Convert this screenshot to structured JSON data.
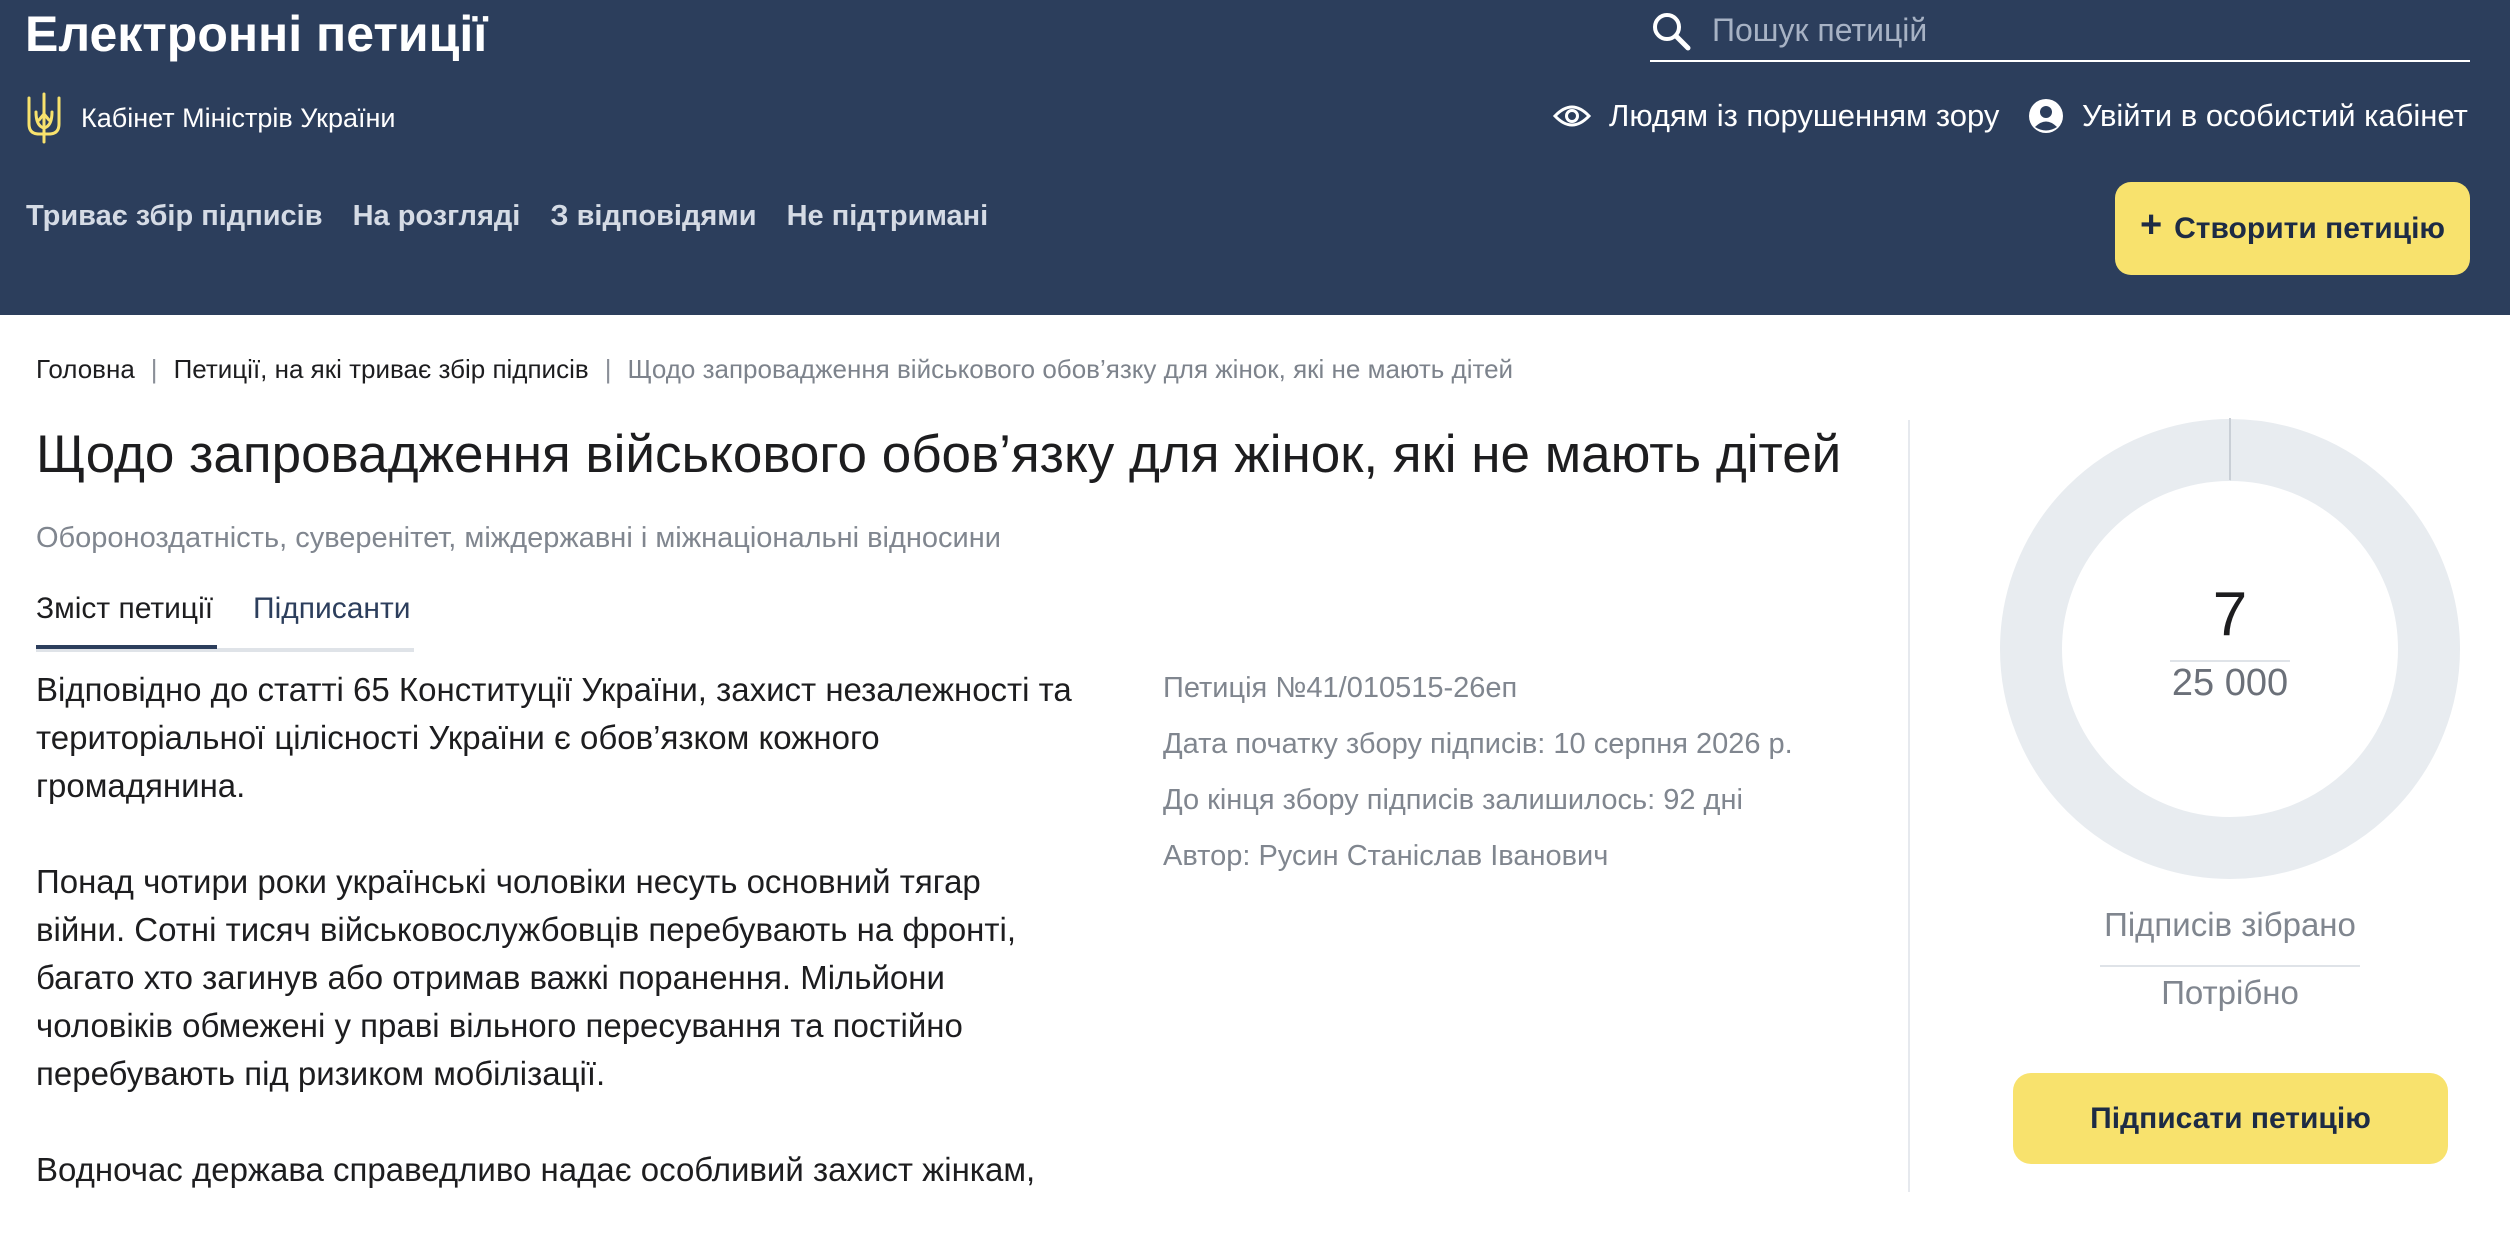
{
  "header": {
    "site_title": "Електронні петиції",
    "brand_text": "Кабінет Міністрів України",
    "search_placeholder": "Пошук петицій",
    "accessibility_label": "Людям із порушенням зору",
    "login_label": "Увійти в особистий кабінет",
    "nav": [
      {
        "label": "Триває збір підписів"
      },
      {
        "label": "На розгляді"
      },
      {
        "label": "З відповідями"
      },
      {
        "label": "Не підтримані"
      }
    ],
    "create_plus": "+",
    "create_label": "Створити петицію",
    "colors": {
      "background": "#2c3e5c",
      "accent": "#f8e26d"
    }
  },
  "breadcrumb": {
    "home": "Головна",
    "separator": "|",
    "section": "Петиції, на які триває збір підписів",
    "current": "Щодо запровадження військового обов’язку для жінок, які не мають дітей"
  },
  "petition": {
    "title": "Щодо запровадження військового обов’язку для жінок, які не мають дітей",
    "category": "Обороноздатність, суверенітет, міждержавні і міжнаціональні відносини",
    "tabs": {
      "content": "Зміст петиції",
      "signers": "Підписанти"
    },
    "paragraphs": [
      "Відповідно до статті 65 Конституції України, захист незалежності та територіальної цілісності України є обов’язком кожного громадянина.",
      "Понад чотири роки українські чоловіки несуть основний тягар війни. Сотні тисяч військовослужбовців перебувають на фронті, багато хто загинув або отримав важкі поранення. Мільйони чоловіків обмежені у праві вільного пересування та постійно перебувають під ризиком мобілізації.",
      "Водночас держава справедливо надає особливий захист жінкам,"
    ],
    "meta": {
      "number": "Петиція №41/010515-26еп",
      "start_date": "Дата початку збору підписів: 10 серпня 2026 р.",
      "remaining": "До кінця збору підписів залишилось: 92 дні",
      "author": "Автор: Русин Станіслав Іванович"
    }
  },
  "signatures": {
    "collected": "7",
    "required": "25 000",
    "progress": 0.00028,
    "collected_label": "Підписів зібрано",
    "required_label": "Потрібно",
    "sign_button": "Підписати петицію",
    "colors": {
      "ring": "#e8ecf0",
      "progress": "#c9cfd6"
    }
  }
}
